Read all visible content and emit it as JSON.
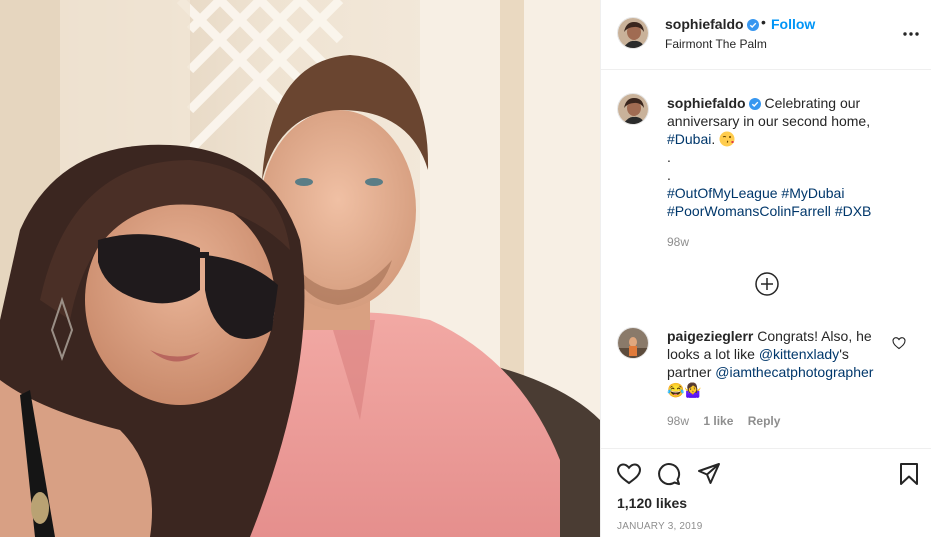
{
  "post": {
    "username": "sophiefaldo",
    "separator": "•",
    "follow_label": "Follow",
    "location": "Fairmont The Palm",
    "caption": {
      "username": "sophiefaldo",
      "text_1": "Celebrating our anniversary in our second home,",
      "tag_dubai": "#Dubai",
      "text_2": ".",
      "dot_1": ".",
      "dot_2": ".",
      "tag_1": "#OutOfMyLeague",
      "tag_2": "#MyDubai",
      "tag_3": "#PoorWomansColinFarrell",
      "tag_4": "#DXB",
      "age": "98w"
    },
    "comment": {
      "username": "paigezieglerr",
      "text_1": "Congrats! Also, he looks a lot like",
      "mention_1": "@kittenxlady",
      "text_2": "'s partner",
      "mention_2": "@iamthecatphotographer",
      "emojis": "😂🤷‍♀️",
      "age": "98w",
      "likes": "1 like",
      "reply": "Reply"
    },
    "likes": "1,120 likes",
    "date": "JANUARY 3, 2019"
  },
  "icons": {
    "verified": "verified-badge-icon",
    "more": "more-options-icon",
    "load_more": "load-more-comments-icon",
    "heart": "heart-icon",
    "comment": "comment-icon",
    "share": "share-icon",
    "save": "bookmark-icon"
  },
  "colors": {
    "link_blue": "#0095f6",
    "hashtag": "#00376b",
    "muted": "#8e8e8e",
    "verified": "#3897f0"
  }
}
